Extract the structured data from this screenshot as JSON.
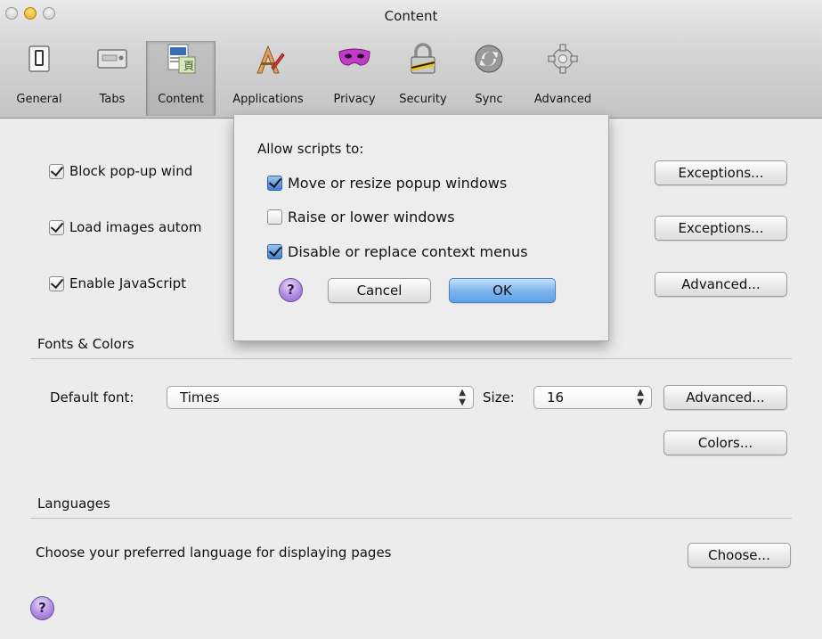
{
  "window": {
    "title": "Content"
  },
  "toolbar": {
    "items": [
      {
        "label": "General",
        "icon": "general-switch-icon"
      },
      {
        "label": "Tabs",
        "icon": "tabs-icon"
      },
      {
        "label": "Content",
        "icon": "content-icon",
        "selected": true
      },
      {
        "label": "Applications",
        "icon": "applications-icon"
      },
      {
        "label": "Privacy",
        "icon": "privacy-mask-icon"
      },
      {
        "label": "Security",
        "icon": "lock-icon"
      },
      {
        "label": "Sync",
        "icon": "sync-icon"
      },
      {
        "label": "Advanced",
        "icon": "gear-icon"
      }
    ]
  },
  "content": {
    "popups": {
      "label": "Block pop-up wind",
      "checked": true,
      "button": "Exceptions..."
    },
    "images": {
      "label": "Load images autom",
      "checked": true,
      "button": "Exceptions..."
    },
    "javascript": {
      "label": "Enable JavaScript",
      "checked": true,
      "button": "Advanced..."
    },
    "fonts_colors": {
      "section": "Fonts & Colors",
      "default_font_label": "Default font:",
      "default_font_value": "Times",
      "size_label": "Size:",
      "size_value": "16",
      "advanced_button": "Advanced...",
      "colors_button": "Colors..."
    },
    "languages": {
      "section": "Languages",
      "description": "Choose your preferred language for displaying pages",
      "choose_button": "Choose..."
    },
    "help_label": "?"
  },
  "sheet": {
    "title": "Allow scripts to:",
    "options": [
      {
        "label": "Move or resize popup windows",
        "checked": true
      },
      {
        "label": "Raise or lower windows",
        "checked": false
      },
      {
        "label": "Disable or replace context menus",
        "checked": true
      }
    ],
    "help_label": "?",
    "cancel_button": "Cancel",
    "ok_button": "OK"
  },
  "colors": {
    "accent": "#5ea2ea",
    "help_purple": "#b08be0"
  }
}
